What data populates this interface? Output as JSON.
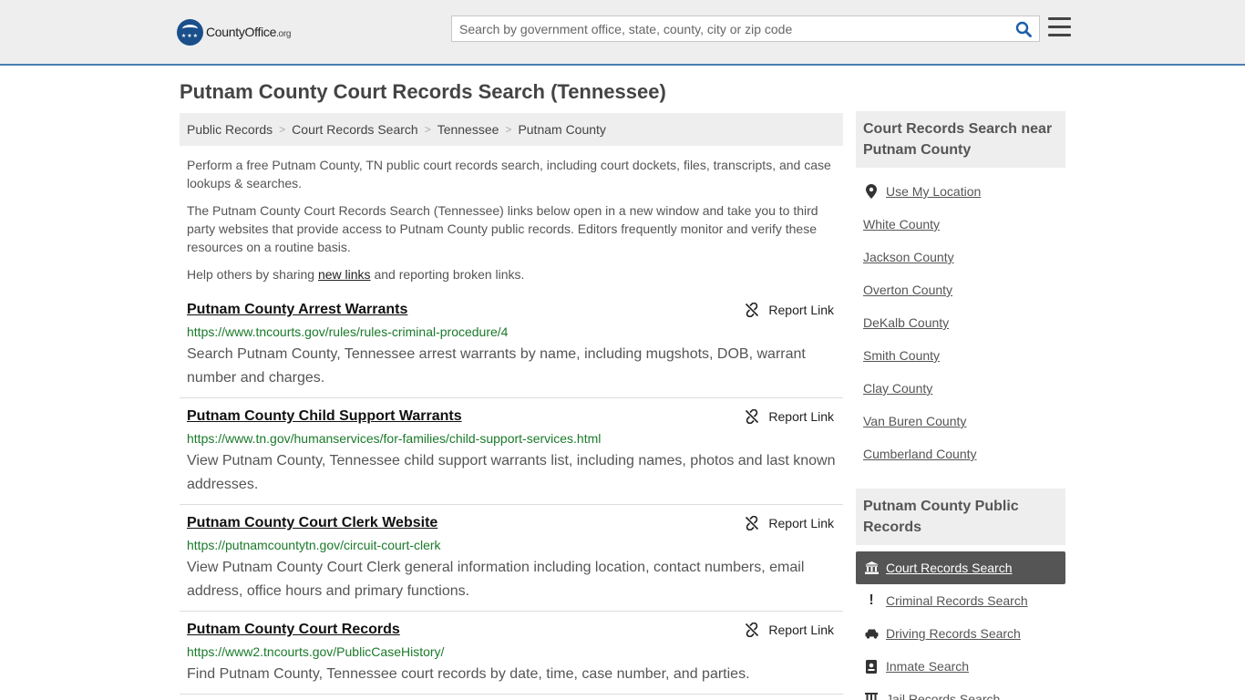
{
  "header": {
    "logo_text_main": "CountyOffice",
    "logo_text_suffix": ".org",
    "search_placeholder": "Search by government office, state, county, city or zip code"
  },
  "page_title": "Putnam County Court Records Search (Tennessee)",
  "breadcrumb": [
    "Public Records",
    "Court Records Search",
    "Tennessee",
    "Putnam County"
  ],
  "intro": {
    "p1": "Perform a free Putnam County, TN public court records search, including court dockets, files, transcripts, and case lookups & searches.",
    "p2": "The Putnam County Court Records Search (Tennessee) links below open in a new window and take you to third party websites that provide access to Putnam County public records. Editors frequently monitor and verify these resources on a routine basis.",
    "p3_before": "Help others by sharing ",
    "p3_link": "new links",
    "p3_after": " and reporting broken links."
  },
  "report_label": "Report Link",
  "records": [
    {
      "title": "Putnam County Arrest Warrants",
      "url": "https://www.tncourts.gov/rules/rules-criminal-procedure/4",
      "desc": "Search Putnam County, Tennessee arrest warrants by name, including mugshots, DOB, warrant number and charges."
    },
    {
      "title": "Putnam County Child Support Warrants",
      "url": "https://www.tn.gov/humanservices/for-families/child-support-services.html",
      "desc": "View Putnam County, Tennessee child support warrants list, including names, photos and last known addresses."
    },
    {
      "title": "Putnam County Court Clerk Website",
      "url": "https://putnamcountytn.gov/circuit-court-clerk",
      "desc": "View Putnam County Court Clerk general information including location, contact numbers, email address, office hours and primary functions."
    },
    {
      "title": "Putnam County Court Records",
      "url": "https://www2.tncourts.gov/PublicCaseHistory/",
      "desc": "Find Putnam County, Tennessee court records by date, time, case number, and parties."
    }
  ],
  "sidebar": {
    "near_heading": "Court Records Search near Putnam County",
    "use_location": "Use My Location",
    "nearby": [
      "White County",
      "Jackson County",
      "Overton County",
      "DeKalb County",
      "Smith County",
      "Clay County",
      "Van Buren County",
      "Cumberland County"
    ],
    "public_heading": "Putnam County Public Records",
    "public_items": [
      {
        "label": "Court Records Search",
        "icon": "courthouse-icon",
        "active": true
      },
      {
        "label": "Criminal Records Search",
        "icon": "exclamation-icon",
        "active": false
      },
      {
        "label": "Driving Records Search",
        "icon": "car-icon",
        "active": false
      },
      {
        "label": "Inmate Search",
        "icon": "id-badge-icon",
        "active": false
      },
      {
        "label": "Jail Records Search",
        "icon": "jail-icon",
        "active": false
      }
    ]
  }
}
